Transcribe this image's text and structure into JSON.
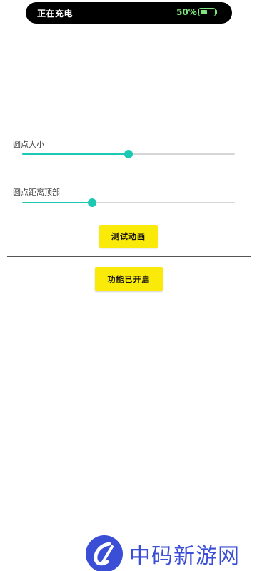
{
  "status": {
    "charging_text": "正在充电",
    "battery_percent_text": "50%",
    "battery_level": 0.5,
    "accent_color": "#7ee67a"
  },
  "settings": {
    "dot_size": {
      "label": "圆点大小",
      "value": 0.5
    },
    "dot_top_distance": {
      "label": "圆点距离顶部",
      "value": 0.33
    },
    "slider_color": "#1ec9b3"
  },
  "buttons": {
    "test_animation": "测试动画",
    "feature_enabled": "功能已开启",
    "color": "#f9ea0a"
  },
  "watermark": {
    "text": "中码新游网"
  }
}
